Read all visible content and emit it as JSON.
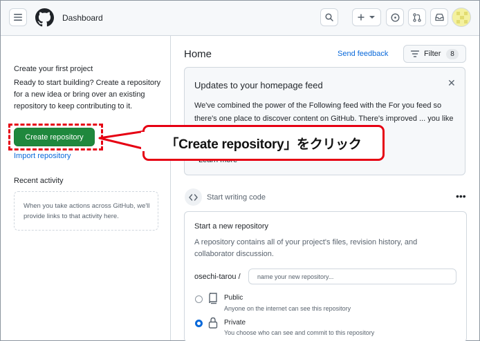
{
  "header": {
    "title": "Dashboard",
    "icons": [
      "menu-icon",
      "github-logo",
      "search-icon",
      "plus-icon",
      "chevron-down-icon",
      "issue-icon",
      "pull-request-icon",
      "inbox-icon",
      "avatar"
    ]
  },
  "sidebar": {
    "heading": "Create your first project",
    "description": "Ready to start building? Create a repository for a new idea or bring over an existing repository to keep contributing to it.",
    "create_button": "Create repository",
    "import_link": "Import repository",
    "recent_heading": "Recent activity",
    "recent_empty": "When you take actions across GitHub, we'll provide links to that activity here."
  },
  "main": {
    "title": "Home",
    "feedback_link": "Send feedback",
    "filter": {
      "label": "Filter",
      "count": "8"
    },
    "updates": {
      "title": "Updates to your homepage feed",
      "body": "We've combined the power of the Following feed with the For you feed so there's one place to discover content on GitHub. There's improved ... you like it, and a",
      "learn_more": "Learn more"
    },
    "start_writing": "Start writing code",
    "new_repo": {
      "title": "Start a new repository",
      "description": "A repository contains all of your project's files, revision history, and collaborator discussion.",
      "owner": "osechi-tarou /",
      "name_placeholder": "name your new repository...",
      "public_label": "Public",
      "public_desc": "Anyone on the internet can see this repository",
      "private_label": "Private",
      "private_desc": "You choose who can see and commit to this repository",
      "selected": "Private"
    }
  },
  "annotation": {
    "callout_text": "「Create repository」をクリック",
    "color": "#e60012"
  },
  "colors": {
    "primary_button": "#1f883d",
    "link": "#0969da",
    "header_bg": "#f6f8fa"
  }
}
